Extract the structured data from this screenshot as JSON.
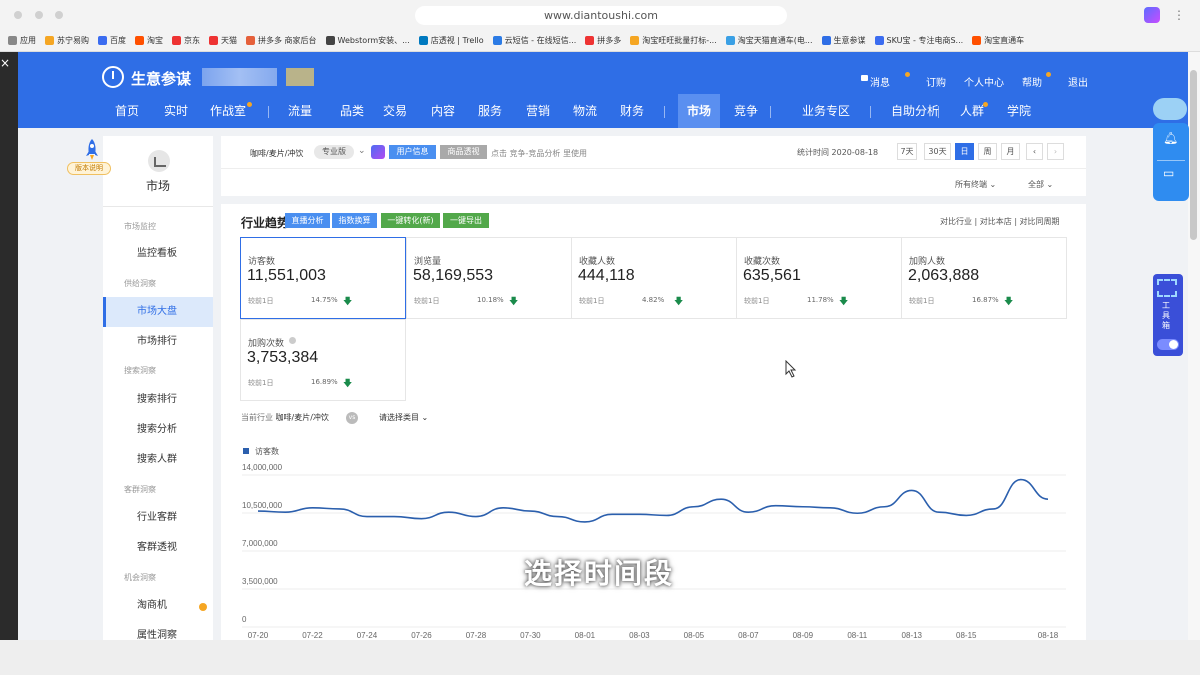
{
  "browser": {
    "url": "www.diantoushi.com",
    "bookmarks": [
      "应用",
      "苏宁易购",
      "百度",
      "淘宝",
      "京东",
      "天猫",
      "拼多多 商家后台",
      "Webstorm安装、...",
      "店透视 | Trello",
      "云短信 - 在线短信...",
      "拼多多",
      "淘宝旺旺批量打标-...",
      "淘宝天猫直通车(电...",
      "生意参谋",
      "SKU宝 - 专注电商S...",
      "淘宝直通车"
    ]
  },
  "header": {
    "brand": "生意参谋",
    "top_links": [
      "消息",
      "订购",
      "个人中心",
      "帮助",
      "退出"
    ],
    "nav": [
      "首页",
      "实时",
      "作战室",
      "流量",
      "品类",
      "交易",
      "内容",
      "服务",
      "营销",
      "物流",
      "财务",
      "市场",
      "竞争",
      "业务专区",
      "自助分析",
      "人群",
      "学院"
    ],
    "active_nav": "市场"
  },
  "sidebar": {
    "title": "市场",
    "version_tag": "版本说明",
    "groups": [
      {
        "label": "市场监控",
        "items": [
          "监控看板"
        ]
      },
      {
        "label": "供给洞察",
        "items": [
          "市场大盘",
          "市场排行"
        ]
      },
      {
        "label": "搜索洞察",
        "items": [
          "搜索排行",
          "搜索分析",
          "搜索人群"
        ]
      },
      {
        "label": "客群洞察",
        "items": [
          "行业客群",
          "客群透视"
        ]
      },
      {
        "label": "机会洞察",
        "items": [
          "淘商机",
          "属性洞察"
        ]
      }
    ],
    "active_item": "市场大盘"
  },
  "filter": {
    "industry": "咖啡/麦片/冲饮",
    "edition": "专业版",
    "user_info_btn": "用户信息",
    "goods_btn": "商品透视",
    "hint": "点击 竞争-竞品分析 里使用",
    "stat_time": "统计时间 2020-08-18",
    "periods": [
      "7天",
      "30天",
      "日",
      "周",
      "月"
    ],
    "active_period": "日",
    "prev": "‹",
    "next": "›",
    "terminal": "所有终端",
    "scope": "全部"
  },
  "trend": {
    "title": "行业趋势",
    "buttons": [
      "直播分析",
      "指数换算",
      "一键转化(新)",
      "一键导出"
    ],
    "compare_links": "对比行业 | 对比本店 | 对比同周期",
    "current_industry_label": "当前行业",
    "current_industry": "咖啡/麦片/冲饮",
    "vs": "vs",
    "choose_category": "请选择类目"
  },
  "metrics": [
    {
      "label": "访客数",
      "value": "11,551,003",
      "compare": "较前1日",
      "pct": "14.75%"
    },
    {
      "label": "浏览量",
      "value": "58,169,553",
      "compare": "较前1日",
      "pct": "10.18%"
    },
    {
      "label": "收藏人数",
      "value": "444,118",
      "compare": "较前1日",
      "pct": "4.82%"
    },
    {
      "label": "收藏次数",
      "value": "635,561",
      "compare": "较前1日",
      "pct": "11.78%"
    },
    {
      "label": "加购人数",
      "value": "2,063,888",
      "compare": "较前1日",
      "pct": "16.87%"
    },
    {
      "label": "加购次数",
      "value": "3,753,384",
      "compare": "较前1日",
      "pct": "16.89%"
    }
  ],
  "chart_data": {
    "type": "line",
    "legend": [
      "访客数"
    ],
    "ylim": [
      0,
      14000000
    ],
    "yticks": [
      "14,000,000",
      "10,500,000",
      "7,000,000",
      "3,500,000",
      "0"
    ],
    "x": [
      "07-20",
      "07-21",
      "07-22",
      "07-23",
      "07-24",
      "07-25",
      "07-26",
      "07-27",
      "07-28",
      "07-29",
      "07-30",
      "07-31",
      "08-01",
      "08-02",
      "08-03",
      "08-04",
      "08-05",
      "08-06",
      "08-07",
      "08-08",
      "08-09",
      "08-10",
      "08-11",
      "08-12",
      "08-13",
      "08-14",
      "08-15",
      "08-16",
      "08-17",
      "08-18"
    ],
    "xticks": [
      "07-20",
      "07-22",
      "07-24",
      "07-26",
      "07-28",
      "07-30",
      "08-01",
      "08-03",
      "08-05",
      "08-07",
      "08-09",
      "08-11",
      "08-13",
      "08-15",
      "08-18"
    ],
    "series": [
      {
        "name": "访客数",
        "color": "#2b5fad",
        "values": [
          10400000,
          10300000,
          10700000,
          10600000,
          9900000,
          9900000,
          9700000,
          10300000,
          9900000,
          10700000,
          10400000,
          9900000,
          9400000,
          10100000,
          10100000,
          10000000,
          10800000,
          11500000,
          10300000,
          10900000,
          10800000,
          10700000,
          10200000,
          10800000,
          12300000,
          10300000,
          10000000,
          10600000,
          13300000,
          11500000
        ]
      }
    ]
  },
  "subtitle": "选择时间段",
  "tools": {
    "toolbox": "工具箱"
  }
}
